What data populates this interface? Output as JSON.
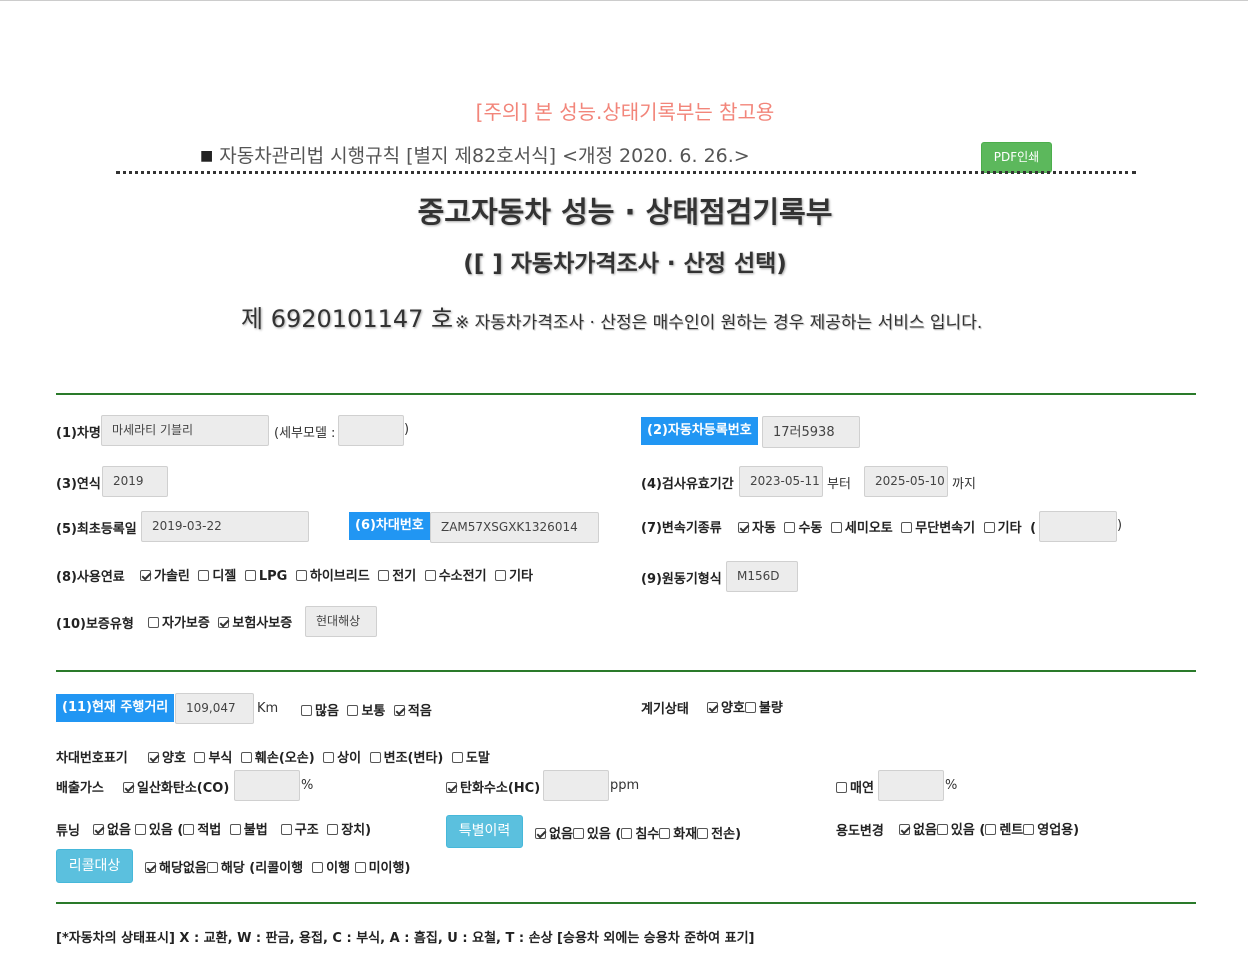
{
  "notice": "[주의] 본 성능.상태기록부는 참고용",
  "law_line": {
    "marker": "■",
    "text": "자동차관리법 시행규칙 [별지 제82호서식] <개정 2020. 6. 26.>"
  },
  "pdf_button": "PDF인쇄",
  "title": "중고자동차 성능 · 상태점검기록부",
  "subtitle": "([   ] 자동차가격조사 · 산정 선택)",
  "doc_number": "제 6920101147 호",
  "doc_note": "※ 자동차가격조사 · 산정은 매수인이 원하는 경우 제공하는 서비스 입니다.",
  "fields": {
    "car_name_label": "(1)차명",
    "car_name": "마세라티 기블리",
    "sub_model_open": "(세부모델 :",
    "sub_model": "",
    "sub_model_close": ")",
    "reg_no_label": "(2)자동차등록번호",
    "reg_no": "17러5938",
    "year_label": "(3)연식",
    "year": "2019",
    "inspect_label": "(4)검사유효기간",
    "inspect_from": "2023-05-11",
    "from_text": "부터",
    "inspect_to": "2025-05-10",
    "to_text": "까지",
    "first_reg_label": "(5)최초등록일",
    "first_reg": "2019-03-22",
    "vin_label": "(6)차대번호",
    "vin": "ZAM57XSGXK1326014",
    "trans_label": "(7)변속기종류",
    "trans_options": [
      {
        "label": "자동",
        "checked": true
      },
      {
        "label": "수동",
        "checked": false
      },
      {
        "label": "세미오토",
        "checked": false
      },
      {
        "label": "무단변속기",
        "checked": false
      },
      {
        "label": "기타",
        "checked": false
      }
    ],
    "trans_other_open": "(",
    "trans_other": "",
    "trans_other_close": ")",
    "fuel_label": "(8)사용연료",
    "fuel_options": [
      {
        "label": "가솔린",
        "checked": true
      },
      {
        "label": "디젤",
        "checked": false
      },
      {
        "label": "LPG",
        "checked": false
      },
      {
        "label": "하이브리드",
        "checked": false
      },
      {
        "label": "전기",
        "checked": false
      },
      {
        "label": "수소전기",
        "checked": false
      },
      {
        "label": "기타",
        "checked": false
      }
    ],
    "engine_label": "(9)원동기형식",
    "engine": "M156D",
    "warranty_label": "(10)보증유형",
    "warranty_options": [
      {
        "label": "자가보증",
        "checked": false
      },
      {
        "label": "보험사보증",
        "checked": true
      }
    ],
    "warranty_company": "현대해상"
  },
  "section2": {
    "mileage_label": "(11)현재 주행거리",
    "mileage": "109,047",
    "mileage_unit": "Km",
    "mileage_options": [
      {
        "label": "많음",
        "checked": false
      },
      {
        "label": "보통",
        "checked": false
      },
      {
        "label": "적음",
        "checked": true
      }
    ],
    "gauge_label": "계기상태",
    "gauge_options": [
      {
        "label": "양호",
        "checked": true
      },
      {
        "label": "불량",
        "checked": false
      }
    ],
    "plate_label": "차대번호표기",
    "plate_options": [
      {
        "label": "양호",
        "checked": true
      },
      {
        "label": "부식",
        "checked": false
      },
      {
        "label": "훼손(오손)",
        "checked": false
      },
      {
        "label": "상이",
        "checked": false
      },
      {
        "label": "변조(변타)",
        "checked": false
      },
      {
        "label": "도말",
        "checked": false
      }
    ],
    "emission_label": "배출가스",
    "co_label": "일산화탄소(CO)",
    "co_checked": true,
    "co_value": "",
    "co_unit": "%",
    "hc_label": "탄화수소(HC)",
    "hc_checked": true,
    "hc_value": "",
    "hc_unit": "ppm",
    "smoke_label": "매연",
    "smoke_checked": false,
    "smoke_value": "",
    "smoke_unit": "%",
    "tuning_label": "튜닝",
    "tuning_none": "없음",
    "tuning_yes": "있음 (",
    "tuning_legal": "적법",
    "tuning_illegal": "불법",
    "tuning_structure": "구조",
    "tuning_device": "장치)",
    "special_button": "특별이력",
    "special_none": "없음",
    "special_yes": "있음 (",
    "special_flood": "침수",
    "special_fire": "화재",
    "special_total": "전손)",
    "usage_label": "용도변경",
    "usage_none": "없음",
    "usage_yes": "있음 (",
    "usage_rent": "렌트",
    "usage_business": "영업용)",
    "recall_button": "리콜대상",
    "recall_none": "해당없음",
    "recall_yes": "해당 (리콜이행",
    "recall_done": "이행",
    "recall_undone": "미이행)"
  },
  "legend": "[*자동차의 상태표시] X : 교환, W : 판금, 용접, C : 부식, A : 흠집, U : 요철, T : 손상 [승용차 외에는 승용차 준하여 표기]"
}
